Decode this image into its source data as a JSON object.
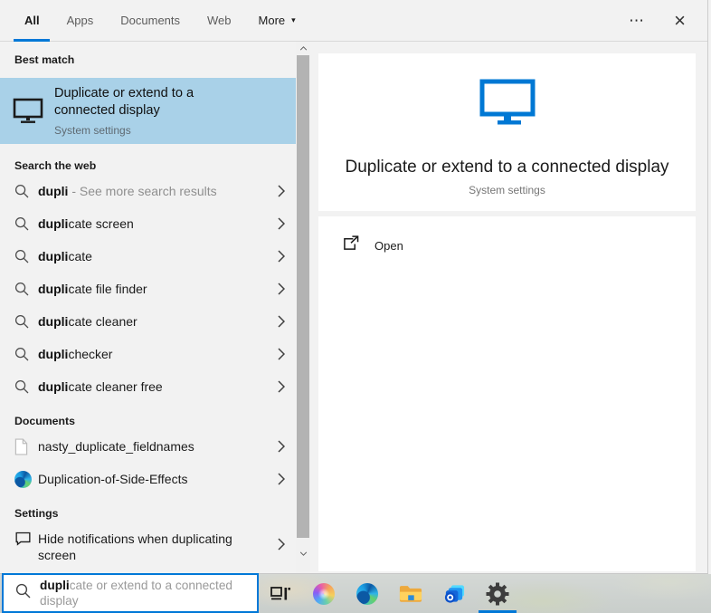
{
  "tabs": {
    "all": "All",
    "apps": "Apps",
    "documents": "Documents",
    "web": "Web",
    "more": "More",
    "more_arrow": "▾",
    "ellipsis": "⋯",
    "close": "×"
  },
  "left": {
    "best_match_header": "Best match",
    "best_match": {
      "title": "Duplicate or extend to a connected display",
      "subtitle": "System settings"
    },
    "web_header": "Search the web",
    "web_items": [
      {
        "bold": "dupli",
        "rest": " - See more search results"
      },
      {
        "bold": "dupli",
        "rest": "cate screen"
      },
      {
        "bold": "dupli",
        "rest": "cate"
      },
      {
        "bold": "dupli",
        "rest": "cate file finder"
      },
      {
        "bold": "dupli",
        "rest": "cate cleaner"
      },
      {
        "bold": "dupli",
        "rest": "checker"
      },
      {
        "bold": "dupli",
        "rest": "cate cleaner free"
      }
    ],
    "documents_header": "Documents",
    "document_items": [
      {
        "label": "nasty_duplicate_fieldnames",
        "icon": "document-icon"
      },
      {
        "label": "Duplication-of-Side-Effects",
        "icon": "edge-icon"
      }
    ],
    "settings_header": "Settings",
    "settings_items": [
      {
        "label": "Hide notifications when duplicating screen",
        "icon": "notification-icon"
      }
    ]
  },
  "preview": {
    "title": "Duplicate or extend to a connected display",
    "subtitle": "System settings",
    "open_label": "Open"
  },
  "search_box": {
    "typed": "dupli",
    "suggestion": "cate or extend to a connected display"
  },
  "taskbar": {
    "icons": [
      "task-view",
      "copilot",
      "edge",
      "file-explorer",
      "outlook",
      "settings"
    ],
    "active_icon": "settings"
  },
  "colors": {
    "accent": "#0078d7",
    "best_match_highlight": "#a9d1e8",
    "panel_bg": "#f2f2f2",
    "scrollbar_thumb": "#b3b3b3"
  }
}
